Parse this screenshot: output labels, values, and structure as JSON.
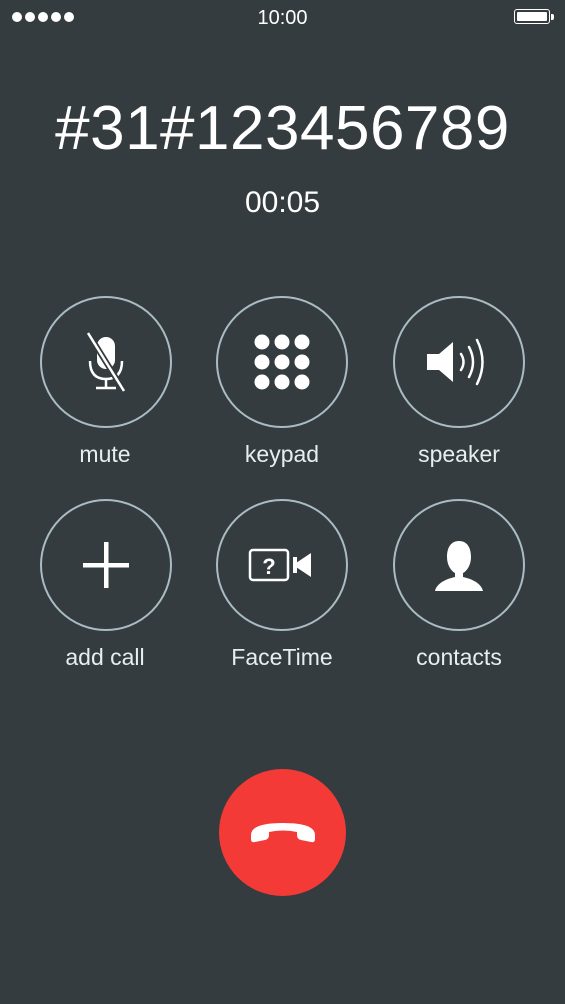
{
  "status_bar": {
    "time": "10:00",
    "signal_icon": "signal-dots-icon",
    "battery_icon": "battery-full-icon"
  },
  "call": {
    "number": "#31#123456789",
    "duration": "00:05"
  },
  "controls": {
    "mute": {
      "label": "mute",
      "icon": "mic-muted-icon"
    },
    "keypad": {
      "label": "keypad",
      "icon": "keypad-grid-icon"
    },
    "speaker": {
      "label": "speaker",
      "icon": "speaker-icon"
    },
    "add_call": {
      "label": "add call",
      "icon": "plus-icon"
    },
    "facetime": {
      "label": "FaceTime",
      "icon": "facetime-unknown-icon"
    },
    "contacts": {
      "label": "contacts",
      "icon": "person-icon"
    }
  },
  "end_call": {
    "icon": "hang-up-icon"
  },
  "colors": {
    "background": "#343c3f",
    "button_ring": "#a9bcc4",
    "end_call": "#f33a36",
    "text": "#ffffff"
  }
}
